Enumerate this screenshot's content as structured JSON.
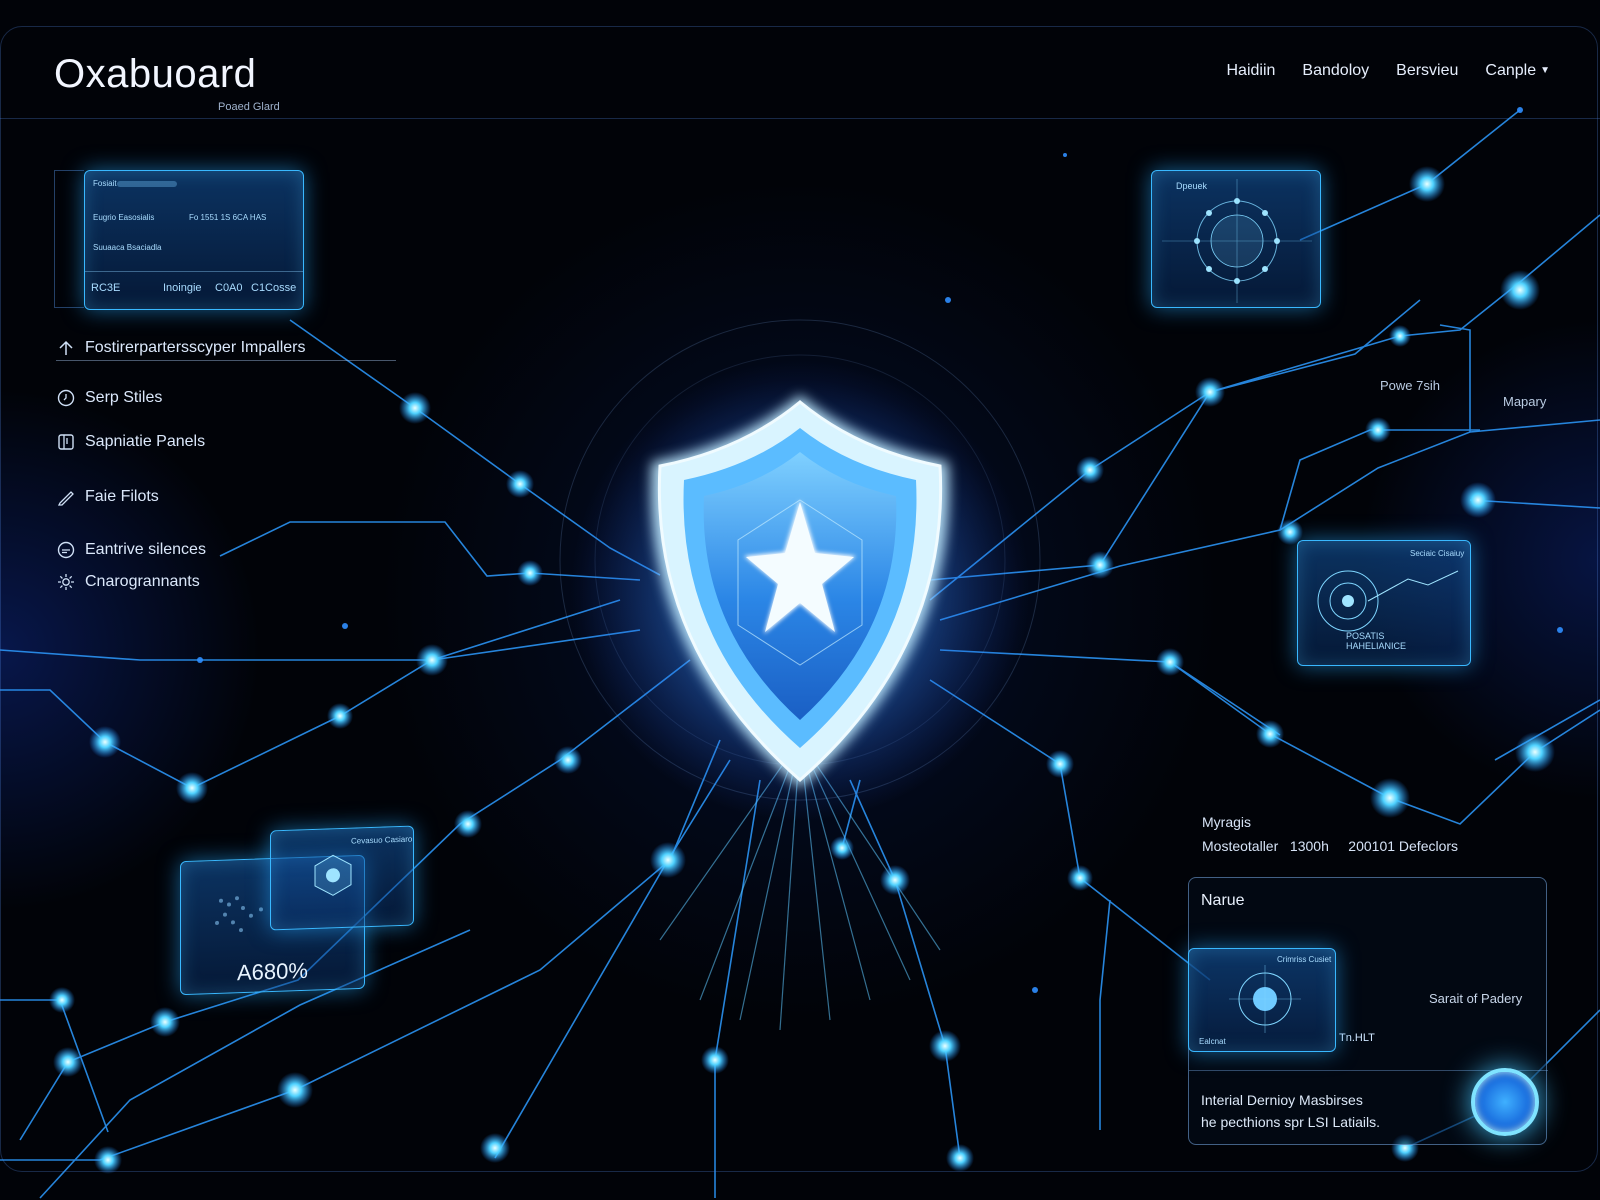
{
  "header": {
    "brand": "Oxabuoard",
    "brand_subtitle": "Poaed Glard",
    "nav": [
      {
        "label": "Haidiin"
      },
      {
        "label": "Bandoloy"
      },
      {
        "label": "Bersviеu"
      },
      {
        "label": "Canple",
        "has_dropdown": true
      }
    ]
  },
  "sidebar": {
    "items": [
      {
        "label": "Fostirerpartersscyper Impallers",
        "icon": "arrow-up-icon"
      },
      {
        "label": "Serp Stiles",
        "icon": "clock-icon"
      },
      {
        "label": "Sapniatie Panels",
        "icon": "panel-icon"
      },
      {
        "label": "Faie Filots",
        "icon": "pencil-icon"
      },
      {
        "label": "Eantrive silences",
        "icon": "chat-icon"
      },
      {
        "label": "Cnarogrannants",
        "icon": "gear-icon"
      }
    ]
  },
  "panels": {
    "top_left": {
      "lines": [
        "Fosiait",
        "Eugrio Easosialis",
        "Fo 1551 1S 6CA HAS",
        "Suuaaca Bsaciadla"
      ],
      "footer": [
        "RC3E",
        "Inoingie",
        "C0A0",
        "C1Cosse"
      ]
    },
    "top_right": {
      "label": "Dpeuek"
    },
    "right_mid": {
      "label_top": "Seciaic Cisaiuy",
      "label_bottom_1": "POSATIS",
      "label_bottom_2": "HAHELIANICE"
    },
    "bottom_left": {
      "percent": "A680%",
      "label": "Cevasuo Casiaro"
    },
    "bottom_right_inner": {
      "label_top": "Crimriss Cusiet",
      "label_bottom": "Ealcnat"
    }
  },
  "annotations": {
    "powe": "Powe 7sih",
    "mapary": "Mapary",
    "myragis": "Myragis",
    "stats": "Mosteotaller   1300h     200101 Defeclors"
  },
  "bottom_panel": {
    "title": "Narue",
    "side_label": "Sarait of Padery",
    "footer_line1": "Interial Dernioy Masbirses",
    "footer_line2": "he pecthions spr LSI Latiails.",
    "mini_label": "Tn.HLT"
  },
  "colors": {
    "background": "#010308",
    "accent": "#39b8ff",
    "glow": "#7fe3ff"
  }
}
